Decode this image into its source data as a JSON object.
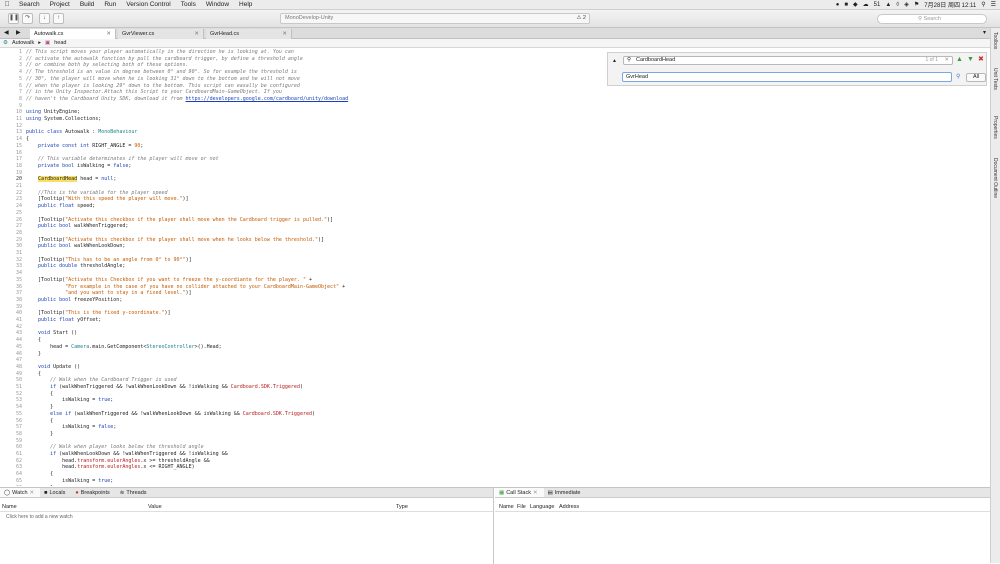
{
  "menubar": {
    "items": [
      "Search",
      "Project",
      "Build",
      "Run",
      "Version Control",
      "Tools",
      "Window",
      "Help"
    ],
    "clock": "7月28日 周四 12:11",
    "badge": "51"
  },
  "toolbar": {
    "status_text": "MonoDevelop-Unity",
    "warning": "⚠ 2",
    "search_placeholder": "Search"
  },
  "tabs": [
    {
      "label": "Autowalk.cs",
      "active": true
    },
    {
      "label": "GvrViewer.cs",
      "active": false
    },
    {
      "label": "GvrHead.cs",
      "active": false
    }
  ],
  "breadcrumb": {
    "class": "Autowalk",
    "member": "head"
  },
  "find": {
    "query": "CardboardHead",
    "count": "1 of 1",
    "replace": "GvrHead",
    "all_label": "All"
  },
  "right_panel": [
    "Toolbox",
    "Unit Tests",
    "Properties",
    "Document Outline"
  ],
  "code_lines": [
    {
      "n": 1,
      "parts": [
        [
          "cm",
          "// This script moves your player automatically in the direction he is looking at. You can"
        ]
      ]
    },
    {
      "n": 2,
      "parts": [
        [
          "cm",
          "// activate the autowalk function by pull the cardboard trigger, by define a threshold angle"
        ]
      ]
    },
    {
      "n": 3,
      "parts": [
        [
          "cm",
          "// or combine both by selecting both of these options."
        ]
      ]
    },
    {
      "n": 4,
      "parts": [
        [
          "cm",
          "// The threshold is an value in degree between 0° and 90°. So for example the threshold is"
        ]
      ]
    },
    {
      "n": 5,
      "parts": [
        [
          "cm",
          "// 30°, the player will move when he is looking 31° down to the bottom and he will not move"
        ]
      ]
    },
    {
      "n": 6,
      "parts": [
        [
          "cm",
          "// when the player is looking 29° down to the bottom. This script can easally be configured"
        ]
      ]
    },
    {
      "n": 7,
      "parts": [
        [
          "cm",
          "// in the Unity Inspector.Attach this Script to your CardboardMain-GameObject. If you"
        ]
      ]
    },
    {
      "n": 8,
      "parts": [
        [
          "cm",
          "// haven't the Cardboard Unity SDK, download it from "
        ],
        [
          "ln",
          "https://developers.google.com/cardboard/unity/download"
        ]
      ]
    },
    {
      "n": 9,
      "parts": []
    },
    {
      "n": 10,
      "parts": [
        [
          "kw",
          "using"
        ],
        [
          "",
          " UnityEngine;"
        ]
      ]
    },
    {
      "n": 11,
      "parts": [
        [
          "kw",
          "using"
        ],
        [
          "",
          " System.Collections;"
        ]
      ]
    },
    {
      "n": 12,
      "parts": []
    },
    {
      "n": 13,
      "parts": [
        [
          "kw",
          "public class"
        ],
        [
          "",
          " Autowalk : "
        ],
        [
          "ty",
          "MonoBehaviour"
        ]
      ]
    },
    {
      "n": 14,
      "parts": [
        [
          "",
          "{"
        ]
      ]
    },
    {
      "n": 15,
      "parts": [
        [
          "kw",
          "    private const int"
        ],
        [
          "",
          " RIGHT_ANGLE = "
        ],
        [
          "st",
          "90"
        ],
        [
          "",
          ";"
        ]
      ]
    },
    {
      "n": 16,
      "parts": []
    },
    {
      "n": 17,
      "parts": [
        [
          "cm",
          "    // This variable determinates if the player will move or not"
        ]
      ]
    },
    {
      "n": 18,
      "parts": [
        [
          "kw",
          "    private bool"
        ],
        [
          "",
          " isWalking = "
        ],
        [
          "kw",
          "false"
        ],
        [
          "",
          ";"
        ]
      ]
    },
    {
      "n": 19,
      "parts": []
    },
    {
      "n": 20,
      "parts": [
        [
          "",
          "    "
        ],
        [
          "hl",
          "CardboardHead"
        ],
        [
          "",
          " head = "
        ],
        [
          "kw",
          "null"
        ],
        [
          "",
          ";"
        ]
      ]
    },
    {
      "n": 21,
      "parts": []
    },
    {
      "n": 22,
      "parts": [
        [
          "cm",
          "    //This is the variable for the player speed"
        ]
      ]
    },
    {
      "n": 23,
      "parts": [
        [
          "",
          "    [Tooltip("
        ],
        [
          "st",
          "\"With this speed the player will move.\""
        ],
        [
          "",
          ")]"
        ]
      ]
    },
    {
      "n": 24,
      "parts": [
        [
          "kw",
          "    public float"
        ],
        [
          "",
          " speed;"
        ]
      ]
    },
    {
      "n": 25,
      "parts": []
    },
    {
      "n": 26,
      "parts": [
        [
          "",
          "    [Tooltip("
        ],
        [
          "st",
          "\"Activate this checkbox if the player shall move when the Cardboard trigger is pulled.\""
        ],
        [
          "",
          ")]"
        ]
      ]
    },
    {
      "n": 27,
      "parts": [
        [
          "kw",
          "    public bool"
        ],
        [
          "",
          " walkWhenTriggered;"
        ]
      ]
    },
    {
      "n": 28,
      "parts": []
    },
    {
      "n": 29,
      "parts": [
        [
          "",
          "    [Tooltip("
        ],
        [
          "st",
          "\"Activate this checkbox if the player shall move when he looks below the threshold.\""
        ],
        [
          "",
          ")]"
        ]
      ]
    },
    {
      "n": 30,
      "parts": [
        [
          "kw",
          "    public bool"
        ],
        [
          "",
          " walkWhenLookDown;"
        ]
      ]
    },
    {
      "n": 31,
      "parts": []
    },
    {
      "n": 32,
      "parts": [
        [
          "",
          "    [Tooltip("
        ],
        [
          "st",
          "\"This has to be an angle from 0° to 90°\""
        ],
        [
          "",
          ")]"
        ]
      ]
    },
    {
      "n": 33,
      "parts": [
        [
          "kw",
          "    public double"
        ],
        [
          "",
          " thresholdAngle;"
        ]
      ]
    },
    {
      "n": 34,
      "parts": []
    },
    {
      "n": 35,
      "parts": [
        [
          "",
          "    [Tooltip("
        ],
        [
          "st",
          "\"Activate this Checkbox if you want to freeze the y-coordiante for the player. \""
        ],
        [
          "",
          " +"
        ]
      ]
    },
    {
      "n": 36,
      "parts": [
        [
          "st",
          "             \"For example in the case of you have no collider attached to your CardboardMain-GameObject\""
        ],
        [
          "",
          " +"
        ]
      ]
    },
    {
      "n": 37,
      "parts": [
        [
          "st",
          "             \"and you want to stay in a fixed level.\""
        ],
        [
          "",
          ")]"
        ]
      ]
    },
    {
      "n": 38,
      "parts": [
        [
          "kw",
          "    public bool"
        ],
        [
          "",
          " freezeYPosition;"
        ]
      ]
    },
    {
      "n": 39,
      "parts": []
    },
    {
      "n": 40,
      "parts": [
        [
          "",
          "    [Tooltip("
        ],
        [
          "st",
          "\"This is the fixed y-coordinate.\""
        ],
        [
          "",
          ")]"
        ]
      ]
    },
    {
      "n": 41,
      "parts": [
        [
          "kw",
          "    public float"
        ],
        [
          "",
          " yOffset;"
        ]
      ]
    },
    {
      "n": 42,
      "parts": []
    },
    {
      "n": 43,
      "parts": [
        [
          "kw",
          "    void"
        ],
        [
          "",
          " Start ()"
        ]
      ]
    },
    {
      "n": 44,
      "parts": [
        [
          "",
          "    {"
        ]
      ]
    },
    {
      "n": 45,
      "parts": [
        [
          "",
          "        head = "
        ],
        [
          "ty",
          "Camera"
        ],
        [
          "",
          ".main.GetComponent<"
        ],
        [
          "ty",
          "StereoController"
        ],
        [
          "",
          ">().Head;"
        ]
      ]
    },
    {
      "n": 46,
      "parts": [
        [
          "",
          "    }"
        ]
      ]
    },
    {
      "n": 47,
      "parts": []
    },
    {
      "n": 48,
      "parts": [
        [
          "kw",
          "    void"
        ],
        [
          "",
          " Update ()"
        ]
      ]
    },
    {
      "n": 49,
      "parts": [
        [
          "",
          "    {"
        ]
      ]
    },
    {
      "n": 50,
      "parts": [
        [
          "cm",
          "        // Walk when the Cardboard Trigger is used"
        ]
      ]
    },
    {
      "n": 51,
      "parts": [
        [
          "kw",
          "        if"
        ],
        [
          "",
          " (walkWhenTriggered && !walkWhenLookDown && !isWalking && "
        ],
        [
          "rd",
          "Cardboard.SDK.Triggered"
        ],
        [
          "",
          ")"
        ]
      ]
    },
    {
      "n": 52,
      "parts": [
        [
          "",
          "        {"
        ]
      ]
    },
    {
      "n": 53,
      "parts": [
        [
          "",
          "            isWalking = "
        ],
        [
          "kw",
          "true"
        ],
        [
          "",
          ";"
        ]
      ]
    },
    {
      "n": 54,
      "parts": [
        [
          "",
          "        }"
        ]
      ]
    },
    {
      "n": 55,
      "parts": [
        [
          "kw",
          "        else if"
        ],
        [
          "",
          " (walkWhenTriggered && !walkWhenLookDown && isWalking && "
        ],
        [
          "rd",
          "Cardboard.SDK.Triggered"
        ],
        [
          "",
          ")"
        ]
      ]
    },
    {
      "n": 56,
      "parts": [
        [
          "",
          "        {"
        ]
      ]
    },
    {
      "n": 57,
      "parts": [
        [
          "",
          "            isWalking = "
        ],
        [
          "kw",
          "false"
        ],
        [
          "",
          ";"
        ]
      ]
    },
    {
      "n": 58,
      "parts": [
        [
          "",
          "        }"
        ]
      ]
    },
    {
      "n": 59,
      "parts": []
    },
    {
      "n": 60,
      "parts": [
        [
          "cm",
          "        // Walk when player looks below the threshold angle"
        ]
      ]
    },
    {
      "n": 61,
      "parts": [
        [
          "kw",
          "        if"
        ],
        [
          "",
          " (walkWhenLookDown && !walkWhenTriggered && !isWalking &&"
        ]
      ]
    },
    {
      "n": 62,
      "parts": [
        [
          "",
          "            head."
        ],
        [
          "rd",
          "transform.eulerAngles"
        ],
        [
          "",
          ".x >= thresholdAngle &&"
        ]
      ]
    },
    {
      "n": 63,
      "parts": [
        [
          "",
          "            head."
        ],
        [
          "rd",
          "transform.eulerAngles"
        ],
        [
          "",
          ".x <= RIGHT_ANGLE)"
        ]
      ]
    },
    {
      "n": 64,
      "parts": [
        [
          "",
          "        {"
        ]
      ]
    },
    {
      "n": 65,
      "parts": [
        [
          "",
          "            isWalking = "
        ],
        [
          "kw",
          "true"
        ],
        [
          "",
          ";"
        ]
      ]
    },
    {
      "n": 66,
      "parts": [
        [
          "",
          "        }"
        ]
      ]
    }
  ],
  "current_line": 20,
  "bottom_left": {
    "tabs": [
      "Watch",
      "Locals",
      "Breakpoints",
      "Threads"
    ],
    "columns": [
      "Name",
      "Value",
      "Type"
    ],
    "hint": "Click here to add a new watch"
  },
  "bottom_right": {
    "tabs": [
      "Call Stack",
      "Immediate"
    ],
    "columns": [
      "Name",
      "File",
      "Language",
      "Address"
    ]
  }
}
